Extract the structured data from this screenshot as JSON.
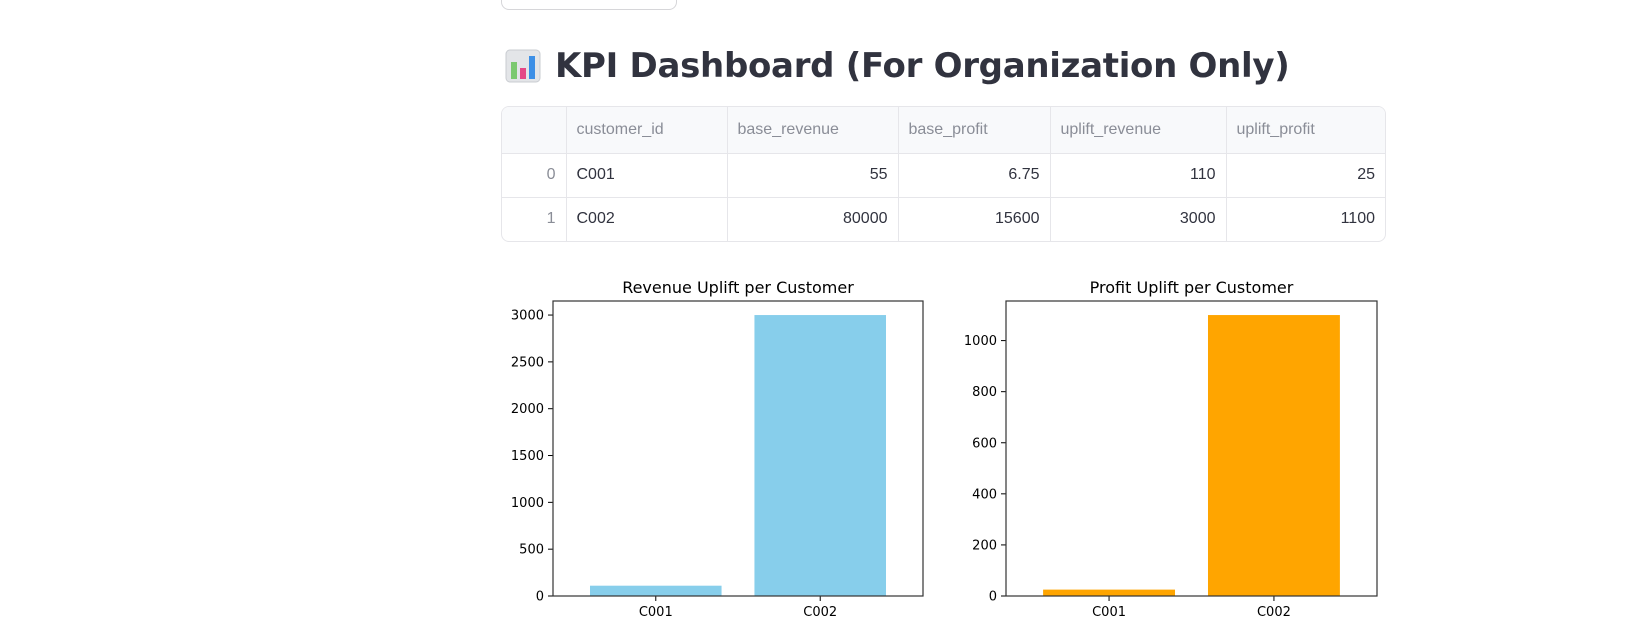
{
  "heading": {
    "title": "KPI Dashboard (For Organization Only)",
    "icon": "bar-chart-emoji-icon"
  },
  "table": {
    "columns": [
      "",
      "customer_id",
      "base_revenue",
      "base_profit",
      "uplift_revenue",
      "uplift_profit"
    ],
    "rows": [
      [
        "0",
        "C001",
        "55",
        "6.75",
        "110",
        "25"
      ],
      [
        "1",
        "C002",
        "80000",
        "15600",
        "3000",
        "1100"
      ]
    ]
  },
  "chart_data": [
    {
      "type": "bar",
      "title": "Revenue Uplift per Customer",
      "categories": [
        "C001",
        "C002"
      ],
      "values": [
        110,
        3000
      ],
      "ylim": [
        0,
        3150
      ],
      "yticks": [
        0,
        500,
        1000,
        1500,
        2000,
        2500,
        3000
      ],
      "color": "#87ceeb",
      "grid": false
    },
    {
      "type": "bar",
      "title": "Profit Uplift per Customer",
      "categories": [
        "C001",
        "C002"
      ],
      "values": [
        25,
        1100
      ],
      "ylim": [
        0,
        1155
      ],
      "yticks": [
        0,
        200,
        400,
        600,
        800,
        1000
      ],
      "color": "#ffa500",
      "grid": false
    }
  ]
}
